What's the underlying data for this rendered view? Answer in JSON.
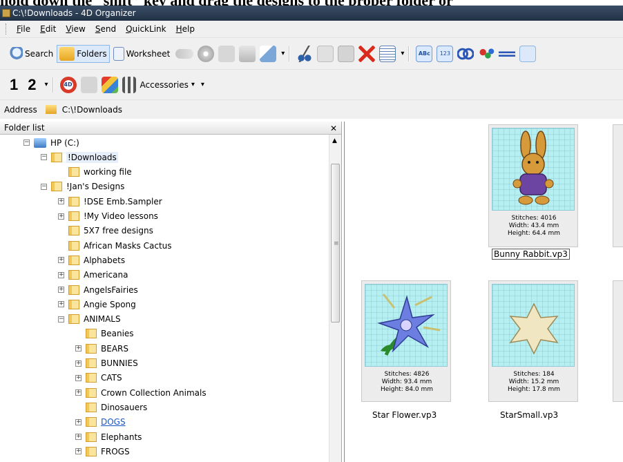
{
  "caption": "hold down the “shift” key and drag the designs to the proper folder or",
  "window": {
    "title": "C:\\!Downloads - 4D Organizer"
  },
  "menu": [
    "File",
    "Edit",
    "View",
    "Send",
    "QuickLink",
    "Help"
  ],
  "toolbar": {
    "search_label": "Search",
    "folders_label": "Folders",
    "worksheet_label": "Worksheet",
    "accessories_label": "Accessories",
    "badge_1": "1",
    "badge_2": "2",
    "abc_label": "ABc",
    "num_label": "123",
    "logo_label": "4D"
  },
  "address": {
    "label": "Address",
    "path": "C:\\!Downloads"
  },
  "folder_list": {
    "header": "Folder list",
    "nodes": [
      {
        "label": "HP (C:)",
        "depth": 0,
        "expander": "−",
        "type": "drive"
      },
      {
        "label": "!Downloads",
        "depth": 1,
        "expander": "−",
        "selected": true
      },
      {
        "label": "working file",
        "depth": 2,
        "expander": ""
      },
      {
        "label": "!Jan's Designs",
        "depth": 1,
        "expander": "−"
      },
      {
        "label": "!DSE Emb.Sampler",
        "depth": 2,
        "expander": "+"
      },
      {
        "label": "!My Video lessons",
        "depth": 2,
        "expander": "+"
      },
      {
        "label": "5X7 free designs",
        "depth": 2,
        "expander": ""
      },
      {
        "label": "African Masks Cactus",
        "depth": 2,
        "expander": ""
      },
      {
        "label": "Alphabets",
        "depth": 2,
        "expander": "+"
      },
      {
        "label": "Americana",
        "depth": 2,
        "expander": "+"
      },
      {
        "label": "AngelsFairies",
        "depth": 2,
        "expander": "+"
      },
      {
        "label": "Angie Spong",
        "depth": 2,
        "expander": "+"
      },
      {
        "label": "ANIMALS",
        "depth": 2,
        "expander": "−"
      },
      {
        "label": "Beanies",
        "depth": 3,
        "expander": ""
      },
      {
        "label": "BEARS",
        "depth": 3,
        "expander": "+"
      },
      {
        "label": "BUNNIES",
        "depth": 3,
        "expander": "+"
      },
      {
        "label": "CATS",
        "depth": 3,
        "expander": "+"
      },
      {
        "label": "Crown Collection Animals",
        "depth": 3,
        "expander": "+"
      },
      {
        "label": "Dinosauers",
        "depth": 3,
        "expander": ""
      },
      {
        "label": "DOGS",
        "depth": 3,
        "expander": "+",
        "link": true
      },
      {
        "label": "Elephants",
        "depth": 3,
        "expander": "+"
      },
      {
        "label": "FROGS",
        "depth": 3,
        "expander": "+"
      }
    ]
  },
  "designs": [
    {
      "stitches": "Stitches: 4016",
      "width": "Width: 43.4 mm",
      "height": "Height: 64.4 mm",
      "filename": "Bunny Rabbit.vp3",
      "focused": true,
      "art": "bunny"
    },
    {
      "stitches": "Stitches: 4826",
      "width": "Width: 93.4 mm",
      "height": "Height: 84.0 mm",
      "filename": "Star Flower.vp3",
      "focused": false,
      "art": "flower"
    },
    {
      "stitches": "Stitches: 184",
      "width": "Width: 15.2 mm",
      "height": "Height: 17.8 mm",
      "filename": "StarSmall.vp3",
      "focused": false,
      "art": "star"
    }
  ],
  "colors": {
    "titlebar": "#2b3c52",
    "thumb_bg": "#b5eff2",
    "link": "#1a55c4",
    "selection": "#e5eef9"
  }
}
